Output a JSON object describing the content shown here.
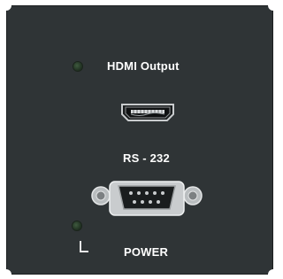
{
  "panel": {
    "hdmi": {
      "label": "HDMI Output",
      "led_state": "off",
      "led_icon": "led-indicator-icon",
      "port_icon": "hdmi-port-icon"
    },
    "rs232": {
      "label": "RS - 232",
      "port_icon": "db9-serial-port-icon"
    },
    "power": {
      "label": "POWER",
      "led_state": "off",
      "led_icon": "led-indicator-icon",
      "mark_icon": "power-corner-mark-icon"
    }
  },
  "colors": {
    "panel": "#2f3436",
    "led_off": "#2a3d2b",
    "text": "#ffffff",
    "metal": "#c9ccce"
  }
}
